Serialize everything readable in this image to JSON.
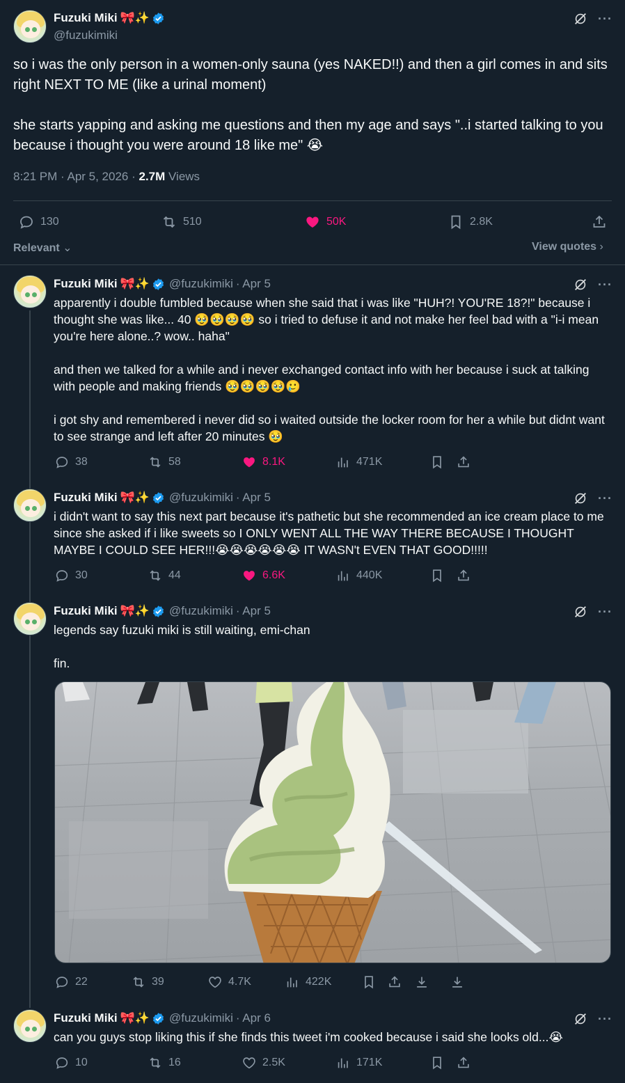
{
  "main_tweet": {
    "author_name": "Fuzuki Miki",
    "name_emoji": "🎀✨",
    "handle": "@fuzukimiki",
    "text": "so i was the only person in a women-only sauna (yes NAKED!!) and then a girl comes in and sits right NEXT TO ME (like a urinal moment)\n\nshe starts yapping and asking me questions and then my age and says \"..i started talking to you because i thought you were around 18 like me\" 😭",
    "time": "8:21 PM · Apr 5, 2026 · ",
    "views_count": "2.7M",
    "views_label": " Views",
    "replies": "130",
    "reposts": "510",
    "likes": "50K",
    "bookmarks": "2.8K",
    "sort_label": "Relevant",
    "view_quotes": "View quotes"
  },
  "replies": [
    {
      "author_name": "Fuzuki Miki",
      "name_emoji": "🎀✨",
      "handle": "@fuzukimiki",
      "date": "· Apr 5",
      "text": "apparently i double fumbled because when she said that i was like \"HUH?! YOU'RE 18?!\" because i thought she was like... 40 🥹🥹🥹🥹 so i tried to defuse it and not make her feel bad with a \"i-i mean you're here alone..? wow.. haha\"\n\nand then we talked for a while and i never exchanged contact info with her because i suck at talking with people and making friends 🥹🥹🥹🥹🥲\n\ni got shy and remembered i never did so i waited outside the locker room for her a while but didnt want to see strange and left after 20 minutes 🥹",
      "replies": "38",
      "reposts": "58",
      "likes": "8.1K",
      "views": "471K"
    },
    {
      "author_name": "Fuzuki Miki",
      "name_emoji": "🎀✨",
      "handle": "@fuzukimiki",
      "date": "· Apr 5",
      "text": "i didn't want to say this next part because it's pathetic but she recommended an ice cream place to me since she asked if i like sweets so I ONLY WENT ALL THE WAY THERE BECAUSE I THOUGHT MAYBE I COULD SEE HER!!!😭😭😭😭😭😭 IT WASN't EVEN THAT GOOD!!!!!",
      "replies": "30",
      "reposts": "44",
      "likes": "6.6K",
      "views": "440K"
    },
    {
      "author_name": "Fuzuki Miki",
      "name_emoji": "🎀✨",
      "handle": "@fuzukimiki",
      "date": "· Apr 5",
      "text": "legends say fuzuki miki is still waiting, emi-chan\n\nfin.",
      "replies": "22",
      "reposts": "39",
      "likes": "4.7K",
      "views": "422K"
    },
    {
      "author_name": "Fuzuki Miki",
      "name_emoji": "🎀✨",
      "handle": "@fuzukimiki",
      "date": "· Apr 6",
      "text": "can you guys stop liking this if she finds this tweet i'm cooked because i said she looks old...😭",
      "replies": "10",
      "reposts": "16",
      "likes": "2.5K",
      "views": "171K"
    }
  ],
  "colors": {
    "background": "#15202b",
    "muted": "#8b98a5",
    "like": "#f91880",
    "verified": "#1d9bf0",
    "divider": "#38444d"
  }
}
